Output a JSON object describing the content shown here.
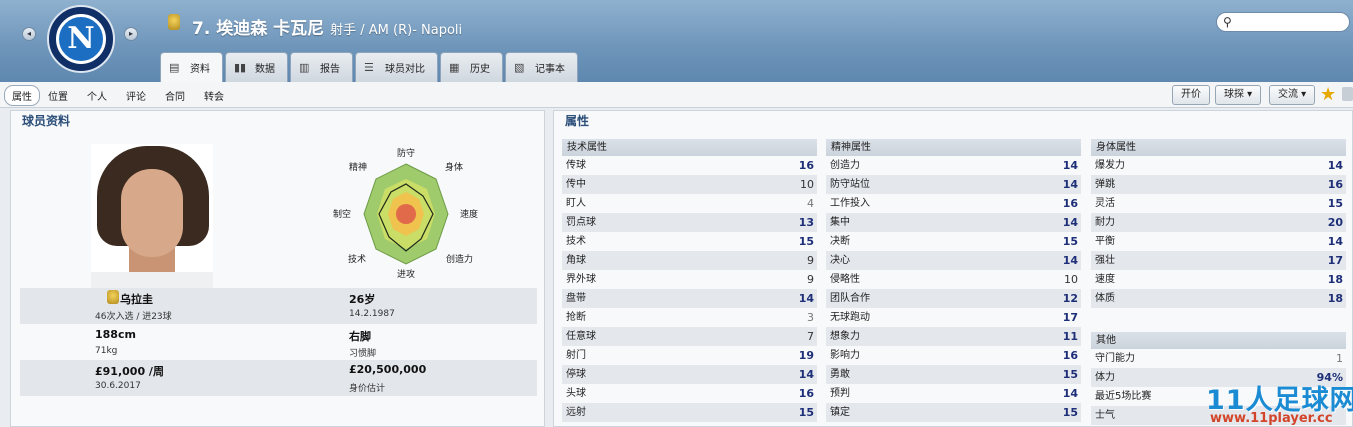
{
  "header": {
    "title": "7. 埃迪森 卡瓦尼",
    "subtitle": "射手 / AM (R)- Napoli",
    "crest_letter": "N",
    "prev_arrow": "◂",
    "next_arrow": "▸"
  },
  "search": {
    "placeholder": ""
  },
  "tabs": [
    {
      "label": "资料",
      "icon": "▤"
    },
    {
      "label": "数据",
      "icon": "▮▮"
    },
    {
      "label": "报告",
      "icon": "▥"
    },
    {
      "label": "球员对比",
      "icon": "☰"
    },
    {
      "label": "历史",
      "icon": "▦"
    },
    {
      "label": "记事本",
      "icon": "▧"
    }
  ],
  "subnav": [
    "属性",
    "位置",
    "个人",
    "评论",
    "合同",
    "转会"
  ],
  "buttons": {
    "offer": "开价",
    "scout": "球探 ▾",
    "interact": "交流 ▾"
  },
  "left": {
    "title": "球员资料",
    "nationality": "乌拉圭",
    "caps": "46次入选 / 进23球",
    "age": "26岁",
    "dob": "14.2.1987",
    "height": "188cm",
    "weight": "71kg",
    "foot": "右脚",
    "foot_label": "习惯脚",
    "wage": "£91,000 /周",
    "contract_end": "30.6.2017",
    "value": "£20,500,000",
    "value_label": "身价估计",
    "radar_labels": [
      "防守",
      "身体",
      "速度",
      "创造力",
      "进攻",
      "技术",
      "制空",
      "精神"
    ]
  },
  "right": {
    "title": "属性",
    "technical": {
      "heading": "技术属性",
      "items": [
        {
          "name": "传球",
          "value": "16"
        },
        {
          "name": "传中",
          "value": "10"
        },
        {
          "name": "盯人",
          "value": "4"
        },
        {
          "name": "罚点球",
          "value": "13"
        },
        {
          "name": "技术",
          "value": "15"
        },
        {
          "name": "角球",
          "value": "9"
        },
        {
          "name": "界外球",
          "value": "9"
        },
        {
          "name": "盘带",
          "value": "14"
        },
        {
          "name": "抢断",
          "value": "3"
        },
        {
          "name": "任意球",
          "value": "7"
        },
        {
          "name": "射门",
          "value": "19"
        },
        {
          "name": "停球",
          "value": "14"
        },
        {
          "name": "头球",
          "value": "16"
        },
        {
          "name": "远射",
          "value": "15"
        }
      ]
    },
    "mental": {
      "heading": "精神属性",
      "items": [
        {
          "name": "创造力",
          "value": "14"
        },
        {
          "name": "防守站位",
          "value": "14"
        },
        {
          "name": "工作投入",
          "value": "16"
        },
        {
          "name": "集中",
          "value": "14"
        },
        {
          "name": "决断",
          "value": "15"
        },
        {
          "name": "决心",
          "value": "14"
        },
        {
          "name": "侵略性",
          "value": "10"
        },
        {
          "name": "团队合作",
          "value": "12"
        },
        {
          "name": "无球跑动",
          "value": "17"
        },
        {
          "name": "想象力",
          "value": "11"
        },
        {
          "name": "影响力",
          "value": "16"
        },
        {
          "name": "勇敢",
          "value": "15"
        },
        {
          "name": "预判",
          "value": "14"
        },
        {
          "name": "镇定",
          "value": "15"
        }
      ]
    },
    "physical": {
      "heading": "身体属性",
      "items": [
        {
          "name": "爆发力",
          "value": "14"
        },
        {
          "name": "弹跳",
          "value": "16"
        },
        {
          "name": "灵活",
          "value": "15"
        },
        {
          "name": "耐力",
          "value": "20"
        },
        {
          "name": "平衡",
          "value": "14"
        },
        {
          "name": "强壮",
          "value": "17"
        },
        {
          "name": "速度",
          "value": "18"
        },
        {
          "name": "体质",
          "value": "18"
        }
      ]
    },
    "other": {
      "heading": "其他",
      "items": [
        {
          "name": "守门能力",
          "value": "1"
        },
        {
          "name": "体力",
          "value": "94%"
        },
        {
          "name": "最近5场比赛",
          "value": ""
        },
        {
          "name": "士气",
          "value": ""
        }
      ]
    }
  },
  "watermark": {
    "big": "11人足球网",
    "small": "www.11player.cc"
  }
}
